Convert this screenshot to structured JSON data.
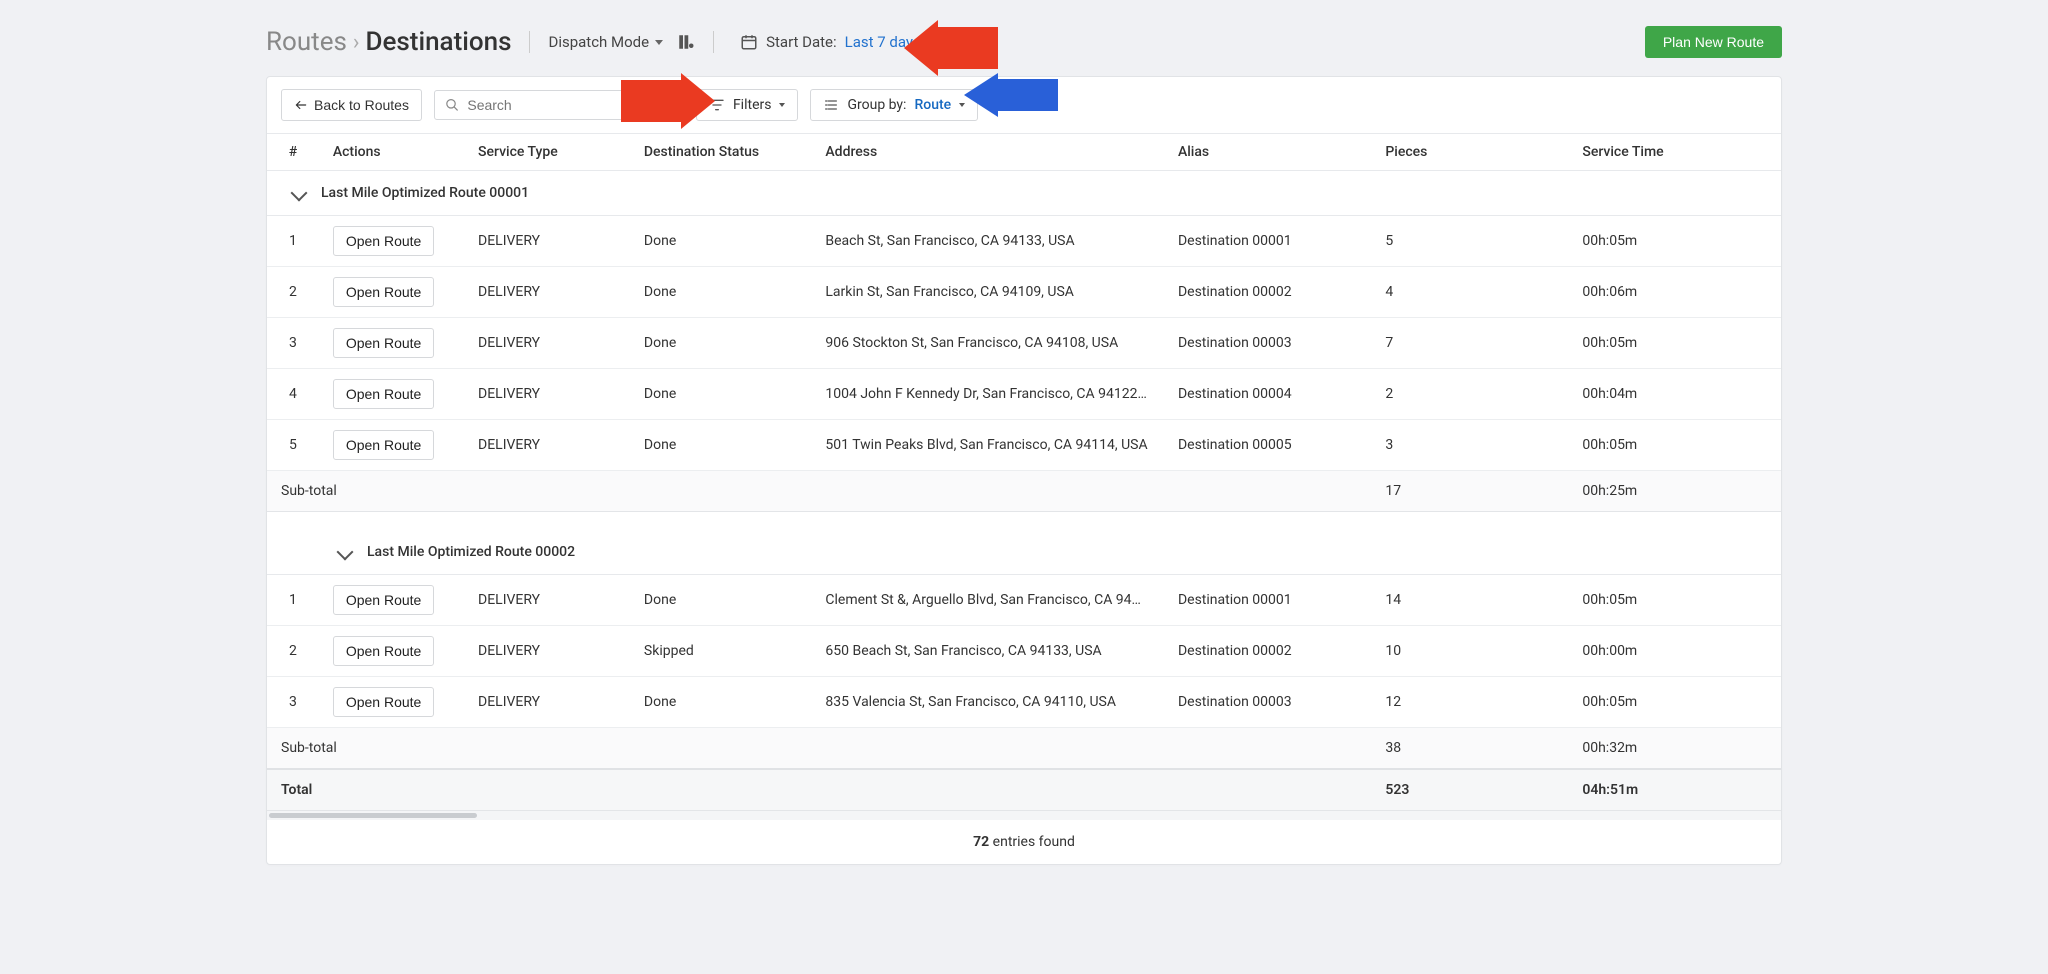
{
  "breadcrumb": {
    "routes": "Routes",
    "destinations": "Destinations",
    "sep": "›"
  },
  "dispatch_mode_label": "Dispatch Mode",
  "start_date": {
    "label": "Start Date:",
    "value": "Last 7 days"
  },
  "plan_new_route_label": "Plan New Route",
  "toolbar": {
    "back_label": "Back to Routes",
    "search_placeholder": "Search",
    "filters_label": "Filters",
    "groupby_label": "Group by:",
    "groupby_value": "Route"
  },
  "columns": {
    "num": "#",
    "actions": "Actions",
    "service_type": "Service Type",
    "dest_status": "Destination Status",
    "address": "Address",
    "alias": "Alias",
    "pieces": "Pieces",
    "service_time": "Service Time"
  },
  "open_route_label": "Open Route",
  "subtotal_label": "Sub-total",
  "total_label": "Total",
  "groups": [
    {
      "title": "Last Mile Optimized Route 00001",
      "rows": [
        {
          "idx": "1",
          "st": "DELIVERY",
          "status": "Done",
          "addr": "Beach St, San Francisco, CA 94133, USA",
          "alias": "Destination 00001",
          "pieces": "5",
          "time": "00h:05m"
        },
        {
          "idx": "2",
          "st": "DELIVERY",
          "status": "Done",
          "addr": "Larkin St, San Francisco, CA 94109, USA",
          "alias": "Destination 00002",
          "pieces": "4",
          "time": "00h:06m"
        },
        {
          "idx": "3",
          "st": "DELIVERY",
          "status": "Done",
          "addr": "906 Stockton St, San Francisco, CA 94108, USA",
          "alias": "Destination 00003",
          "pieces": "7",
          "time": "00h:05m"
        },
        {
          "idx": "4",
          "st": "DELIVERY",
          "status": "Done",
          "addr": "1004 John F Kennedy Dr, San Francisco, CA 94122…",
          "alias": "Destination 00004",
          "pieces": "2",
          "time": "00h:04m"
        },
        {
          "idx": "5",
          "st": "DELIVERY",
          "status": "Done",
          "addr": "501 Twin Peaks Blvd, San Francisco, CA 94114, USA",
          "alias": "Destination 00005",
          "pieces": "3",
          "time": "00h:05m"
        }
      ],
      "subtotal": {
        "pieces": "17",
        "time": "00h:25m"
      }
    },
    {
      "title": "Last Mile Optimized Route 00002",
      "rows": [
        {
          "idx": "1",
          "st": "DELIVERY",
          "status": "Done",
          "addr": "Clement St &, Arguello Blvd, San Francisco, CA 94…",
          "alias": "Destination 00001",
          "pieces": "14",
          "time": "00h:05m"
        },
        {
          "idx": "2",
          "st": "DELIVERY",
          "status": "Skipped",
          "addr": "650 Beach St, San Francisco, CA 94133, USA",
          "alias": "Destination 00002",
          "pieces": "10",
          "time": "00h:00m"
        },
        {
          "idx": "3",
          "st": "DELIVERY",
          "status": "Done",
          "addr": "835 Valencia St, San Francisco, CA 94110, USA",
          "alias": "Destination 00003",
          "pieces": "12",
          "time": "00h:05m"
        }
      ],
      "subtotal": {
        "pieces": "38",
        "time": "00h:32m"
      }
    }
  ],
  "total": {
    "pieces": "523",
    "time": "04h:51m"
  },
  "entries_found": {
    "count": "72",
    "label": "entries found"
  }
}
